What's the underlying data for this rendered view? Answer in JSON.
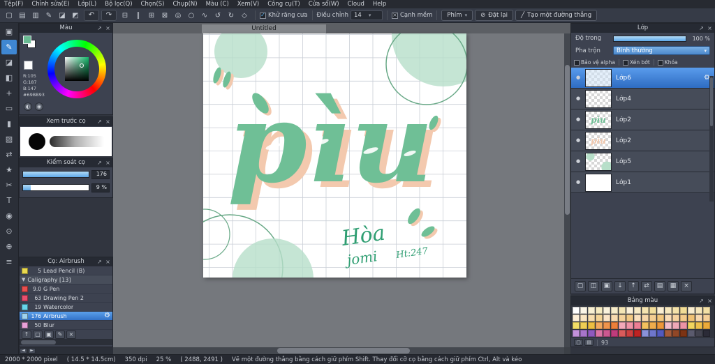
{
  "colors": {
    "accent": "#4A90D9",
    "mint": "#6FBF96",
    "shadow_salmon": "#F3C9AE",
    "blob_fill": "#B7DFC9",
    "blob_stroke": "#69A987",
    "signature_green": "#2F9E72",
    "grid": "#C9CED6"
  },
  "icons": {
    "chevron_down": "▾",
    "close": "×",
    "popout": "↗",
    "check": "✓",
    "gear": "⚙",
    "eye_dot": "●",
    "folder_arrow": "▼",
    "left_arrow": "◄",
    "right_arrow": "►",
    "half_circle": "◐",
    "dot_circle": "◉"
  },
  "menu_bar": {
    "items": [
      "Tệp(F)",
      "Chỉnh sửa(E)",
      "Lớp(L)",
      "Bộ lọc(Q)",
      "Chọn(S)",
      "Chụp(N)",
      "Màu (C)",
      "Xem(V)",
      "Công cụ(T)",
      "Cửa sổ(W)",
      "Cloud",
      "Help"
    ]
  },
  "toolbar": {
    "file_icons": [
      {
        "name": "new-file",
        "glyph": "▢"
      },
      {
        "name": "open-file",
        "glyph": "▤"
      },
      {
        "name": "save-file",
        "glyph": "▥"
      },
      {
        "name": "brush-mode",
        "glyph": "✎"
      },
      {
        "name": "eraser-mode",
        "glyph": "◪"
      },
      {
        "name": "select-mode",
        "glyph": "◩"
      }
    ],
    "undo_icon": "↶",
    "redo_icon": "↷",
    "snap_icons": [
      {
        "name": "snap-off",
        "glyph": "⊟"
      },
      {
        "name": "snap-parallel",
        "glyph": "∥"
      },
      {
        "name": "snap-crosshatch",
        "glyph": "⊞"
      },
      {
        "name": "snap-vanishing-point",
        "glyph": "⊠"
      },
      {
        "name": "snap-radial",
        "glyph": "◎"
      },
      {
        "name": "snap-ellipse",
        "glyph": "○"
      },
      {
        "name": "snap-curve",
        "glyph": "∿"
      },
      {
        "name": "rotate-view-left",
        "glyph": "↺"
      },
      {
        "name": "rotate-view-right",
        "glyph": "↻"
      },
      {
        "name": "reset-view",
        "glyph": "◇"
      }
    ],
    "antialias": {
      "label": "Khử răng cưa",
      "state_glyph": "✓"
    },
    "adjust": {
      "label": "Điều chỉnh",
      "value": "14"
    },
    "soft_edge": {
      "label": "Cạnh mềm",
      "state_glyph": "×"
    },
    "key_button": {
      "label": "Phím"
    },
    "reset_button": {
      "label": "Đặt lại",
      "icon": "⊘"
    },
    "line_button": {
      "label": "Tạo một đường thẳng",
      "icon": "╱"
    }
  },
  "left_toolbar": {
    "tools": [
      {
        "name": "frame-tool",
        "glyph": "▣",
        "selected": false
      },
      {
        "name": "brush-tool",
        "glyph": "✎",
        "selected": true
      },
      {
        "name": "eraser-tool",
        "glyph": "◪",
        "selected": false
      },
      {
        "name": "fill-tool",
        "glyph": "◧",
        "selected": false
      },
      {
        "name": "move-tool",
        "glyph": "+",
        "selected": false
      },
      {
        "name": "select-tool",
        "glyph": "▭",
        "selected": false
      },
      {
        "name": "bucket-tool",
        "glyph": "▮",
        "selected": false
      },
      {
        "name": "gradient-tool",
        "glyph": "▨",
        "selected": false
      },
      {
        "name": "transform-tool",
        "glyph": "⇄",
        "selected": false
      },
      {
        "name": "magic-wand-tool",
        "glyph": "★",
        "selected": false
      },
      {
        "name": "select-pen-tool",
        "glyph": "✂",
        "selected": false
      },
      {
        "name": "text-tool",
        "glyph": "T",
        "selected": false
      },
      {
        "name": "eyedropper-tool",
        "glyph": "◉",
        "selected": false
      },
      {
        "name": "hand-tool",
        "glyph": "⊙",
        "selected": false
      },
      {
        "name": "zoom-tool",
        "glyph": "⊕",
        "selected": false
      },
      {
        "name": "divide-tool",
        "glyph": "≡",
        "selected": false
      }
    ]
  },
  "color_panel": {
    "title": "Màu",
    "r": "R:105",
    "g": "G:187",
    "b": "B:147",
    "hex": "#69BB93"
  },
  "brush_preview_panel": {
    "title": "Xem trước cọ"
  },
  "brush_control_panel": {
    "title": "Kiểm soát cọ",
    "rows": [
      {
        "name": "brush-size",
        "value": "176",
        "fill": 1
      },
      {
        "name": "brush-opacity",
        "value": "9 %",
        "fill": 0.12
      }
    ]
  },
  "brush_list_panel": {
    "title": "Cọ: Airbrush",
    "brushes": [
      {
        "type": "brush",
        "badge": "#E9D94F",
        "size": "5",
        "name": "Lead Pencil (B)",
        "selected": false
      },
      {
        "type": "folder",
        "name": "Caligraphy [13]"
      },
      {
        "type": "brush",
        "badge": "#E94F4F",
        "size": "9.0",
        "name": "G Pen",
        "selected": false
      },
      {
        "type": "brush",
        "badge": "#E94F6E",
        "size": "63",
        "name": "Drawing Pen 2",
        "selected": false
      },
      {
        "type": "brush",
        "badge": "#67D6EA",
        "size": "19",
        "name": "Watercolor",
        "selected": false
      },
      {
        "type": "brush",
        "badge": "#9FD2EF",
        "size": "176",
        "name": "Airbrush",
        "selected": true
      },
      {
        "type": "brush",
        "badge": "#E9A0D8",
        "size": "50",
        "name": "Blur",
        "selected": false
      }
    ],
    "tool_icons": [
      {
        "name": "move-brush-up-button",
        "glyph": "↑"
      },
      {
        "name": "add-brush-button",
        "glyph": "▢"
      },
      {
        "name": "brush-folder-button",
        "glyph": "▣"
      },
      {
        "name": "edit-brush-button",
        "glyph": "✎"
      },
      {
        "name": "delete-brush-button",
        "glyph": "×"
      }
    ]
  },
  "canvas": {
    "tab": "Untitled",
    "word": "pìu",
    "signature": [
      "Hòa",
      "jomi",
      "Ht:247"
    ]
  },
  "layers_panel": {
    "title": "Lớp",
    "opacity_label": "Độ trong",
    "opacity_value": "100 %",
    "blend_label": "Pha trộn",
    "blend_value": "Bình thường",
    "options": [
      {
        "name": "protect-alpha",
        "label": "Bảo vệ alpha"
      },
      {
        "name": "clipping",
        "label": "Xén bớt"
      },
      {
        "name": "lock",
        "label": "Khóa"
      }
    ],
    "layers": [
      {
        "name": "Lớp6",
        "content": "tint",
        "selected": true
      },
      {
        "name": "Lớp4",
        "content": "empty",
        "selected": false
      },
      {
        "name": "Lớp2",
        "content": "word-green",
        "selected": false
      },
      {
        "name": "Lớp2",
        "content": "word-salmon",
        "selected": false
      },
      {
        "name": "Lớp5",
        "content": "blobs",
        "selected": false
      },
      {
        "name": "Lớp1",
        "content": "white",
        "selected": false
      }
    ],
    "tool_icons": [
      {
        "name": "add-layer-button",
        "glyph": "▢"
      },
      {
        "name": "duplicate-layer-button",
        "glyph": "◫"
      },
      {
        "name": "add-folder-button",
        "glyph": "▣"
      },
      {
        "name": "merge-down-button",
        "glyph": "↓"
      },
      {
        "name": "move-layer-up-button",
        "glyph": "↑"
      },
      {
        "name": "convert-layer-button",
        "glyph": "⇄"
      },
      {
        "name": "import-layer-button",
        "glyph": "▤"
      },
      {
        "name": "material-button",
        "glyph": "▦"
      },
      {
        "name": "delete-layer-button",
        "glyph": "×"
      }
    ]
  },
  "palette_panel": {
    "title": "Bảng màu",
    "count": "93",
    "tool_icons": [
      {
        "name": "add-color-button",
        "glyph": "▢"
      },
      {
        "name": "palette-menu-button",
        "glyph": "▤"
      }
    ],
    "rows": [
      [
        "#FFFFFF",
        "#FBF6E7",
        "#F8F0D2",
        "#F6EBC0",
        "#FAF2DC",
        "#F7ECC9",
        "#F4E5B4",
        "#FBF0D8",
        "#F8EAC4",
        "#F5E4B0",
        "#F2DE9C",
        "#FAEED2",
        "#F7E8BE",
        "#F4E2AA",
        "#F1DC96",
        "#F9ECCE",
        "#F6E6BA",
        "#F3E0A6"
      ],
      [
        "#FDEFD8",
        "#FAE6C2",
        "#F7DDAC",
        "#F4D496",
        "#FBE4C6",
        "#F8DBB0",
        "#F5D29A",
        "#F2C984",
        "#FAE0BE",
        "#F7D7A8",
        "#F4CE92",
        "#F1C57C",
        "#F9DCB6",
        "#F6D3A0",
        "#F3CA8A",
        "#F0C174",
        "#F8D8AE",
        "#F5CF98"
      ],
      [
        "#F2DE66",
        "#EFCE54",
        "#ECBE42",
        "#F2A95E",
        "#EF944C",
        "#EC7F3A",
        "#F2A9B9",
        "#EF94A7",
        "#EC7F95",
        "#F2C15E",
        "#EFAC4C",
        "#EC973A",
        "#F2BDC9",
        "#EFA8B7",
        "#EC93A5",
        "#F2D55E",
        "#EFC04C",
        "#ECAB3A"
      ],
      [
        "#C291DA",
        "#A875CC",
        "#8E59BE",
        "#DA74A4",
        "#CC5890",
        "#BE3C7C",
        "#DA5B5B",
        "#CC3F3F",
        "#BE2323",
        "#8A92DA",
        "#6E76CC",
        "#525ABE",
        "#A45B3B",
        "#904727",
        "#7C3313",
        "#5B5B6E",
        "#43434F",
        "#2B2B37"
      ]
    ]
  },
  "status_bar": {
    "dimensions": "2000 * 2000 pixel",
    "size_cm": "( 14.5 * 14.5cm)",
    "dpi": "350 dpi",
    "zoom": "25 %",
    "coords": "( 2488, 2491 )",
    "hint": "Vẽ một đường thẳng bằng cách giữ phím Shift. Thay đổi cỡ cọ bằng cách giữ phím Ctrl, Alt và kéo"
  }
}
